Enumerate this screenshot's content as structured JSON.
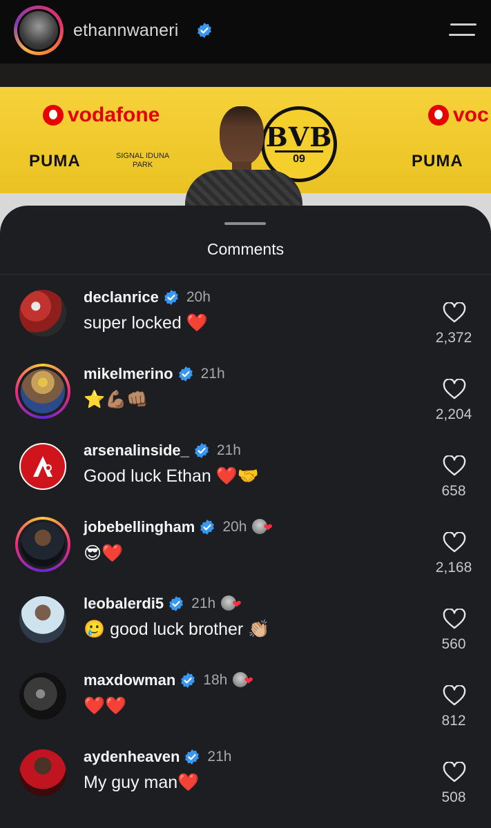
{
  "header": {
    "username": "ethannwaneri",
    "verified": true
  },
  "background": {
    "sponsor_1": "vodafone",
    "sponsor_1_partial": "voc",
    "sponsor_2": "PUMA",
    "sponsor_3_line1": "SIGNAL IDUNA",
    "sponsor_3_line2": "PARK",
    "club_logo_text": "BVB",
    "club_logo_year": "09"
  },
  "sheet": {
    "title": "Comments"
  },
  "comments": [
    {
      "user": "declanrice",
      "time": "20h",
      "text": "super locked ❤️",
      "likes": "2,372",
      "author_liked": false
    },
    {
      "user": "mikelmerino",
      "time": "21h",
      "text": "⭐💪🏽👊🏽",
      "likes": "2,204",
      "author_liked": false
    },
    {
      "user": "arsenalinside_",
      "time": "21h",
      "text": "Good luck Ethan ❤️🤝",
      "likes": "658",
      "author_liked": false
    },
    {
      "user": "jobebellingham",
      "time": "20h",
      "text": "😎❤️",
      "likes": "2,168",
      "author_liked": true
    },
    {
      "user": "leobalerdi5",
      "time": "21h",
      "text": "🥲 good luck brother 👏🏼",
      "likes": "560",
      "author_liked": true
    },
    {
      "user": "maxdowman",
      "time": "18h",
      "text": "❤️❤️",
      "likes": "812",
      "author_liked": true
    },
    {
      "user": "aydenheaven",
      "time": "21h",
      "text": "My guy man❤️",
      "likes": "508",
      "author_liked": false
    }
  ],
  "colors": {
    "verified_blue": "#3897f0",
    "sheet_bg": "#1c1e22",
    "heart_red": "#ff2d44",
    "board_yellow": "#f6d23a"
  }
}
